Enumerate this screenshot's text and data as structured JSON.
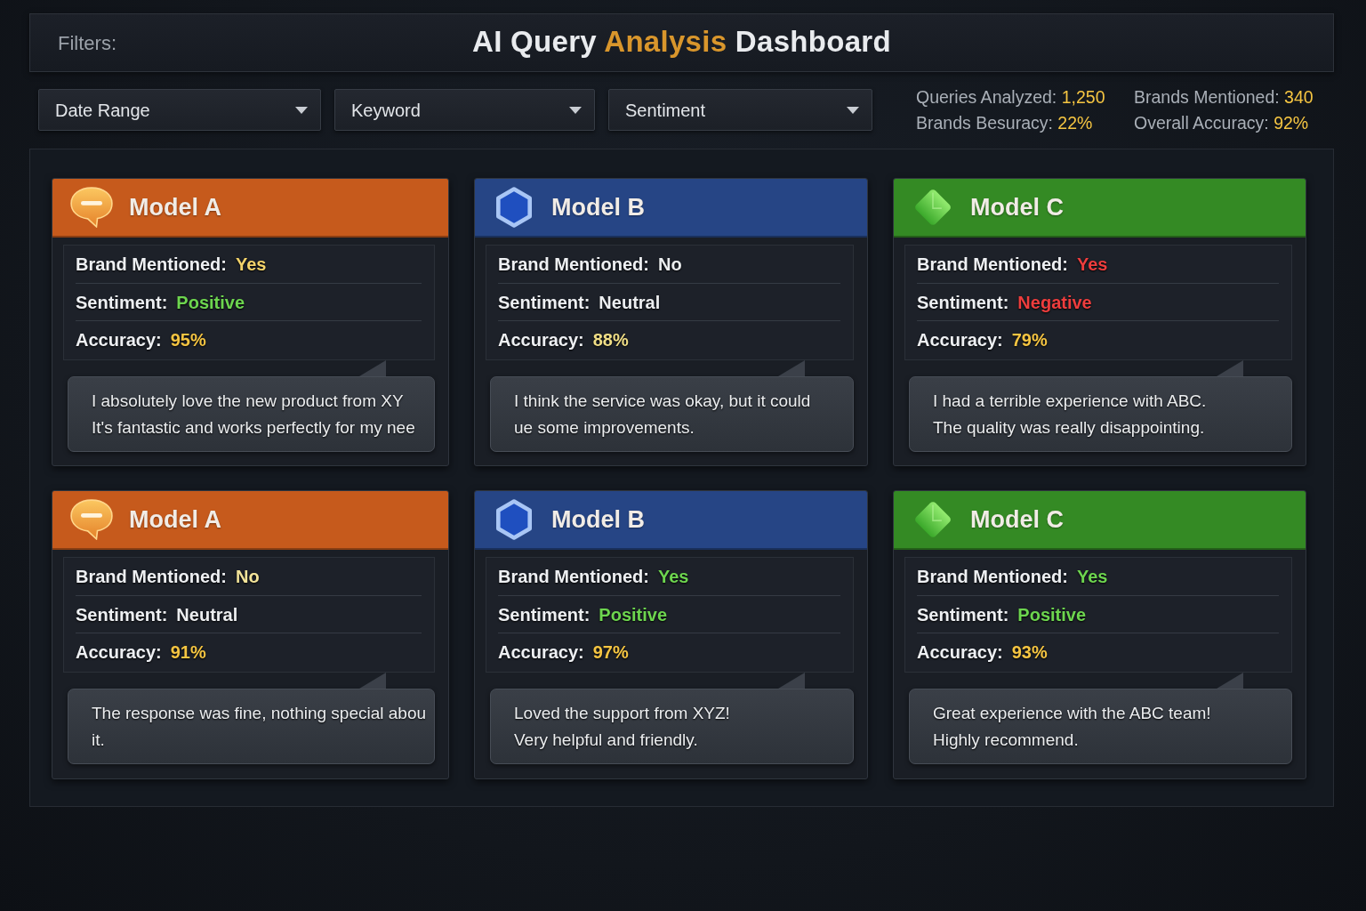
{
  "header": {
    "filters_label": "Filters:",
    "title": [
      {
        "text": "AI Query",
        "accent": false
      },
      {
        "text": "Analysis",
        "accent": true
      },
      {
        "text": "Dashboard",
        "accent": false
      }
    ]
  },
  "filters": [
    {
      "label": "Date Range"
    },
    {
      "label": "Keyword"
    },
    {
      "label": "Sentiment"
    }
  ],
  "stats": [
    {
      "label": "Queries Analyzed:",
      "value": "1,250"
    },
    {
      "label": "Brands Mentioned:",
      "value": "340"
    },
    {
      "label": "Brands Besuracy:",
      "value": "22%"
    },
    {
      "label": "Overall Accuracy:",
      "value": "92%"
    }
  ],
  "cards": [
    {
      "model": "Model A",
      "kind": "chat",
      "color": "#c65a1c",
      "fields": [
        {
          "label": "Brand Mentioned:",
          "value": "Yes",
          "color": "#f3d36a"
        },
        {
          "label": "Sentiment:",
          "value": "Positive",
          "color": "#6dd54f"
        },
        {
          "label": "Accuracy:",
          "value": "95%",
          "color": "#f5c542"
        }
      ],
      "quote": "I absolutely love the new product from XY\nIt's fantastic and works perfectly for my nee"
    },
    {
      "model": "Model B",
      "kind": "hexagon",
      "color": "#264585",
      "fields": [
        {
          "label": "Brand Mentioned:",
          "value": "No",
          "color": "#eceef0"
        },
        {
          "label": "Sentiment:",
          "value": "Neutral",
          "color": "#eceef0"
        },
        {
          "label": "Accuracy:",
          "value": "88%",
          "color": "#f0de86"
        }
      ],
      "quote": "I think the service was okay, but it could\nue some improvements."
    },
    {
      "model": "Model C",
      "kind": "diamond",
      "color": "#348a24",
      "fields": [
        {
          "label": "Brand Mentioned:",
          "value": "Yes",
          "color": "#ee3d3d"
        },
        {
          "label": "Sentiment:",
          "value": "Negative",
          "color": "#ee3d3d"
        },
        {
          "label": "Accuracy:",
          "value": "79%",
          "color": "#f5c542"
        }
      ],
      "quote": "I had a terrible experience with ABC.\nThe quality was really disappointing."
    },
    {
      "model": "Model A",
      "kind": "chat",
      "color": "#c65a1c",
      "fields": [
        {
          "label": "Brand Mentioned:",
          "value": "No",
          "color": "#f3e49a"
        },
        {
          "label": "Sentiment:",
          "value": "Neutral",
          "color": "#eceef0"
        },
        {
          "label": "Accuracy:",
          "value": "91%",
          "color": "#f5c542"
        }
      ],
      "quote": "The response was fine, nothing special abou\nit."
    },
    {
      "model": "Model B",
      "kind": "hexagon",
      "color": "#264585",
      "fields": [
        {
          "label": "Brand Mentioned:",
          "value": "Yes",
          "color": "#6dd54f"
        },
        {
          "label": "Sentiment:",
          "value": "Positive",
          "color": "#6dd54f"
        },
        {
          "label": "Accuracy:",
          "value": "97%",
          "color": "#f5c542"
        }
      ],
      "quote": "Loved the support from XYZ!\nVery helpful and friendly."
    },
    {
      "model": "Model C",
      "kind": "diamond",
      "color": "#348a24",
      "fields": [
        {
          "label": "Brand Mentioned:",
          "value": "Yes",
          "color": "#6dd54f"
        },
        {
          "label": "Sentiment:",
          "value": "Positive",
          "color": "#6dd54f"
        },
        {
          "label": "Accuracy:",
          "value": "93%",
          "color": "#f5c542"
        }
      ],
      "quote": "Great experience with the ABC team!\nHighly recommend."
    }
  ]
}
